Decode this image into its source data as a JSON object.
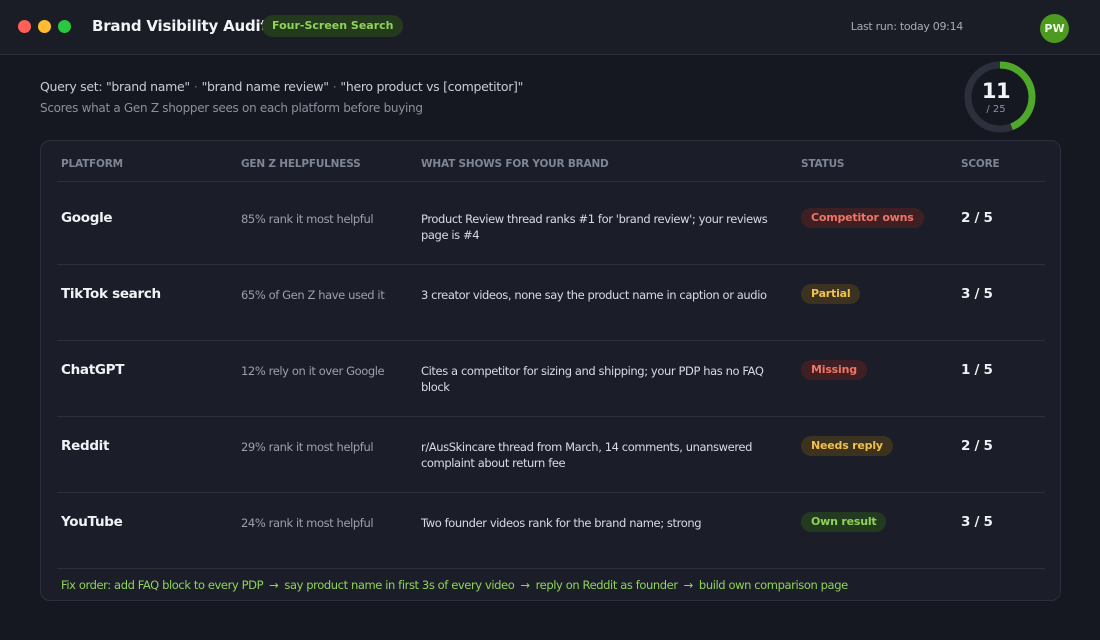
{
  "window": {
    "title": "Brand Visibility Audit",
    "mode_badge": "Four-Screen Search",
    "last_run": "Last run: today 09:14",
    "user_initials": "PW"
  },
  "query": {
    "label": "Query set:",
    "terms": [
      "\"brand name\"",
      "\"brand name review\"",
      "\"hero product vs [competitor]\""
    ],
    "description": "Scores what a Gen Z shopper sees on each platform before buying"
  },
  "overall": {
    "score": "11",
    "total_label": "/ 25",
    "score_value": 11,
    "max_value": 25,
    "ring_color": "#4fa82a"
  },
  "table": {
    "columns": [
      "PLATFORM",
      "GEN Z HELPFULNESS",
      "WHAT SHOWS FOR YOUR BRAND",
      "STATUS",
      "SCORE"
    ],
    "rows": [
      {
        "platform": "Google",
        "helpfulness": "85% rank it most helpful",
        "what_shows": "Product Review thread ranks #1 for 'brand review'; your reviews page is #4",
        "status": "Competitor owns",
        "status_tone": "red",
        "score": "2 / 5"
      },
      {
        "platform": "TikTok search",
        "helpfulness": "65% of Gen Z have used it",
        "what_shows": "3 creator videos, none say the product name in caption or audio",
        "status": "Partial",
        "status_tone": "amber",
        "score": "3 / 5"
      },
      {
        "platform": "ChatGPT",
        "helpfulness": "12% rely on it over Google",
        "what_shows": "Cites a competitor for sizing and shipping; your PDP has no FAQ block",
        "status": "Missing",
        "status_tone": "red",
        "score": "1 / 5"
      },
      {
        "platform": "Reddit",
        "helpfulness": "29% rank it most helpful",
        "what_shows": "r/AusSkincare thread from March, 14 comments, unanswered complaint about return fee",
        "status": "Needs reply",
        "status_tone": "amber",
        "score": "2 / 5"
      },
      {
        "platform": "YouTube",
        "helpfulness": "24% rank it most helpful",
        "what_shows": "Two founder videos rank for the brand name; strong",
        "status": "Own result",
        "status_tone": "green",
        "score": "3 / 5"
      }
    ]
  },
  "fix_order": {
    "label": "Fix order:",
    "steps": [
      "add FAQ block to every PDP",
      "say product name in first 3s of every video",
      "reply on Reddit as founder",
      "build own comparison page"
    ]
  },
  "colors": {
    "accent_green": "#8fd35a",
    "status_red": "#f07466",
    "status_amber": "#f1c14b"
  }
}
